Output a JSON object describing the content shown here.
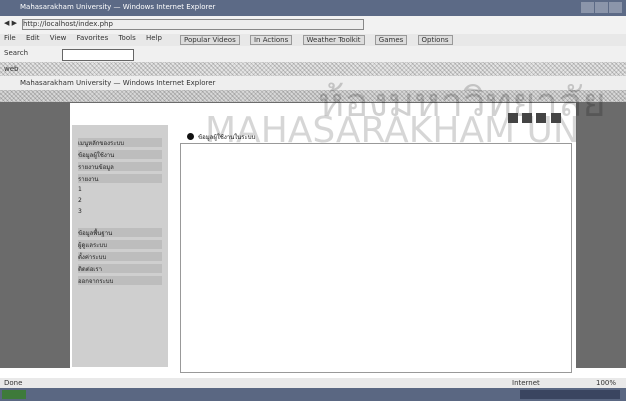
{
  "window": {
    "title": "Mahasarakham University — Windows Internet Explorer"
  },
  "browser": {
    "address": "http://localhost/index.php",
    "menu": [
      "File",
      "Edit",
      "View",
      "Favorites",
      "Tools",
      "Help"
    ],
    "toolbar_buttons": [
      "Popular Videos",
      "In Actions",
      "Weather Toolkit",
      "Games",
      "Options"
    ],
    "search_label": "Search",
    "tabs": [
      "web"
    ],
    "page_zoom": "100%"
  },
  "left_nav": {
    "items": [
      "เมนูหลักของระบบ",
      "ข้อมูลผู้ใช้งาน",
      "รายงานข้อมูล",
      "รายงาน",
      "1",
      "2",
      "3",
      "ข้อมูลพื้นฐาน",
      "ผู้ดูแลระบบ",
      "ตั้งค่าระบบ",
      "ติดต่อเรา",
      "ออกจากระบบ"
    ]
  },
  "pane": {
    "title": "ข้อมูลผู้ใช้งานในระบบ"
  },
  "status": {
    "left": "Done",
    "right": "Internet",
    "zoom": "100%"
  },
  "watermark": {
    "line1": "ห้องมหาวิทยาลัย",
    "line2": "MAHASARAKHAM UN"
  }
}
